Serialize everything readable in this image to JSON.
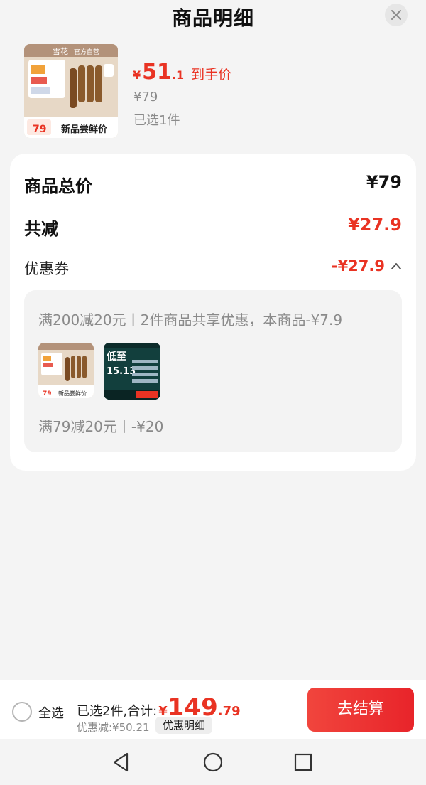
{
  "header": {
    "title": "商品明细"
  },
  "product": {
    "promo_price_symbol": "¥",
    "promo_price_int": "51",
    "promo_price_dec": ".1",
    "promo_label": "到手价",
    "original_price": "¥79",
    "selected": "已选1件",
    "thumb_brand": "雪花",
    "thumb_store": "官方自营",
    "thumb_price": "79",
    "thumb_tag": "新品尝鲜价"
  },
  "summary": {
    "total_label": "商品总价",
    "total_value": "¥79",
    "reduce_label": "共减",
    "reduce_value": "¥27.9",
    "coupon_label": "优惠券",
    "coupon_value": "-¥27.9"
  },
  "coupon_details": {
    "line1": "满200减20元丨2件商品共享优惠，本商品-¥7.9",
    "line2": "满79减20元丨-¥20",
    "mini_price": "79",
    "mini_tag": "新品尝鲜价",
    "mini2_text": "低至",
    "mini2_num": "15.13"
  },
  "bottom_bar": {
    "select_all": "全选",
    "total_label": "已选2件,合计:",
    "total_symbol": "¥",
    "total_int": "149",
    "total_dec": ".79",
    "discount": "优惠减:¥50.21",
    "detail_button": "优惠明细",
    "checkout": "去结算"
  },
  "colors": {
    "accent": "#e93323",
    "background": "#f4f4f4",
    "card": "#ffffff"
  },
  "icons": {
    "close": "close-icon",
    "collapse": "chevron-up-icon",
    "back": "back-triangle-icon",
    "home": "home-circle-icon",
    "recents": "recents-square-icon"
  }
}
